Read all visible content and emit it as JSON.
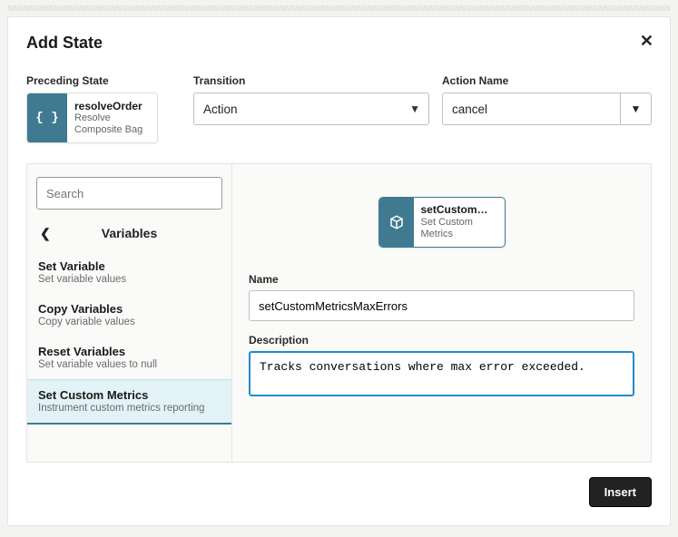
{
  "dialog": {
    "title": "Add State",
    "insert_label": "Insert"
  },
  "labels": {
    "preceding_state": "Preceding State",
    "transition": "Transition",
    "action_name": "Action Name",
    "name": "Name",
    "description": "Description"
  },
  "preceding_state": {
    "title": "resolveOrder",
    "subtitle1": "Resolve",
    "subtitle2": "Composite Bag",
    "icon_text": "{ }"
  },
  "transition": {
    "value": "Action"
  },
  "action_name": {
    "value": "cancel"
  },
  "search": {
    "placeholder": "Search"
  },
  "crumb": {
    "title": "Variables",
    "back_icon": "❮"
  },
  "sidebar": {
    "items": [
      {
        "title": "Set Variable",
        "desc": "Set variable values",
        "selected": false
      },
      {
        "title": "Copy Variables",
        "desc": "Copy variable values",
        "selected": false
      },
      {
        "title": "Reset Variables",
        "desc": "Set variable values to null",
        "selected": false
      },
      {
        "title": "Set Custom Metrics",
        "desc": "Instrument custom metrics reporting",
        "selected": true
      }
    ]
  },
  "preview": {
    "title": "setCustomMet…",
    "subtitle1": "Set Custom",
    "subtitle2": "Metrics"
  },
  "form": {
    "name_value": "setCustomMetricsMaxErrors",
    "description_value": "Tracks conversations where max error exceeded."
  }
}
